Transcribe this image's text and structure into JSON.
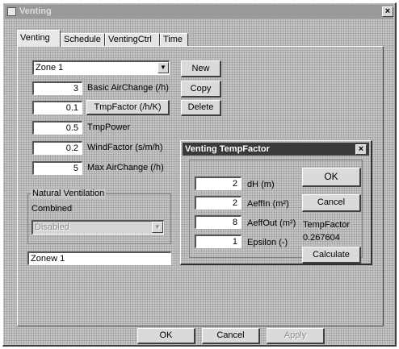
{
  "window": {
    "title": "Venting"
  },
  "tabs": [
    {
      "label": "Venting"
    },
    {
      "label": "Schedule"
    },
    {
      "label": "VentingCtrl"
    },
    {
      "label": "Time"
    }
  ],
  "zone_select": {
    "value": "Zone 1"
  },
  "fields": {
    "basic_airchange": {
      "value": "3",
      "label": "Basic AirChange (/h)"
    },
    "tmp_factor": {
      "value": "0.1",
      "label": "TmpFactor (/h/K)"
    },
    "tmp_power": {
      "value": "0.5",
      "label": "TmpPower"
    },
    "wind_factor": {
      "value": "0.2",
      "label": "WindFactor (s/m/h)"
    },
    "max_airchange": {
      "value": "5",
      "label": "Max AirChange (/h)"
    }
  },
  "side_buttons": {
    "new": "New",
    "copy": "Copy",
    "delete": "Delete"
  },
  "natural_ventilation": {
    "group_title": "Natural Ventilation",
    "mode_label": "Combined",
    "select_value": "Disabled"
  },
  "status_field": {
    "value": "Zonew 1"
  },
  "bottom_buttons": {
    "ok": "OK",
    "cancel": "Cancel",
    "apply": "Apply"
  },
  "dialog": {
    "title": "Venting TempFactor",
    "fields": {
      "dh": {
        "value": "2",
        "label": "dH (m)"
      },
      "aeff_in": {
        "value": "2",
        "label": "AeffIn (m²)"
      },
      "aeff_out": {
        "value": "8",
        "label": "AeffOut (m²)"
      },
      "epsilon": {
        "value": "1",
        "label": "Epsilon (-)"
      }
    },
    "ok": "OK",
    "cancel": "Cancel",
    "result_label": "TempFactor",
    "result_value": "0.267604",
    "calculate": "Calculate"
  }
}
